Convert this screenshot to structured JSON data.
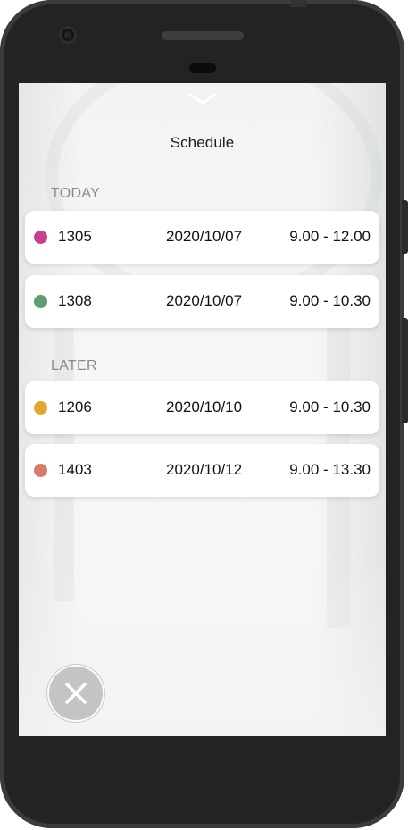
{
  "title": "Schedule",
  "sections": [
    {
      "label": "TODAY",
      "items": [
        {
          "room": "1305",
          "date": "2020/10/07",
          "time": "9.00 - 12.00",
          "color": "#c93f8e"
        },
        {
          "room": "1308",
          "date": "2020/10/07",
          "time": "9.00 - 10.30",
          "color": "#5d9e71"
        }
      ]
    },
    {
      "label": "LATER",
      "items": [
        {
          "room": "1206",
          "date": "2020/10/10",
          "time": "9.00 - 10.30",
          "color": "#e2a62e"
        },
        {
          "room": "1403",
          "date": "2020/10/12",
          "time": "9.00 - 13.30",
          "color": "#d97a68"
        }
      ]
    }
  ],
  "icons": {
    "collapse": "chevron-down-icon",
    "close": "close-icon"
  },
  "colors": {
    "phone_frame": "#232323",
    "screen_bg": "#f5f5f5",
    "section_label": "#8a8a8a",
    "close_button": "#c4c4c4"
  }
}
